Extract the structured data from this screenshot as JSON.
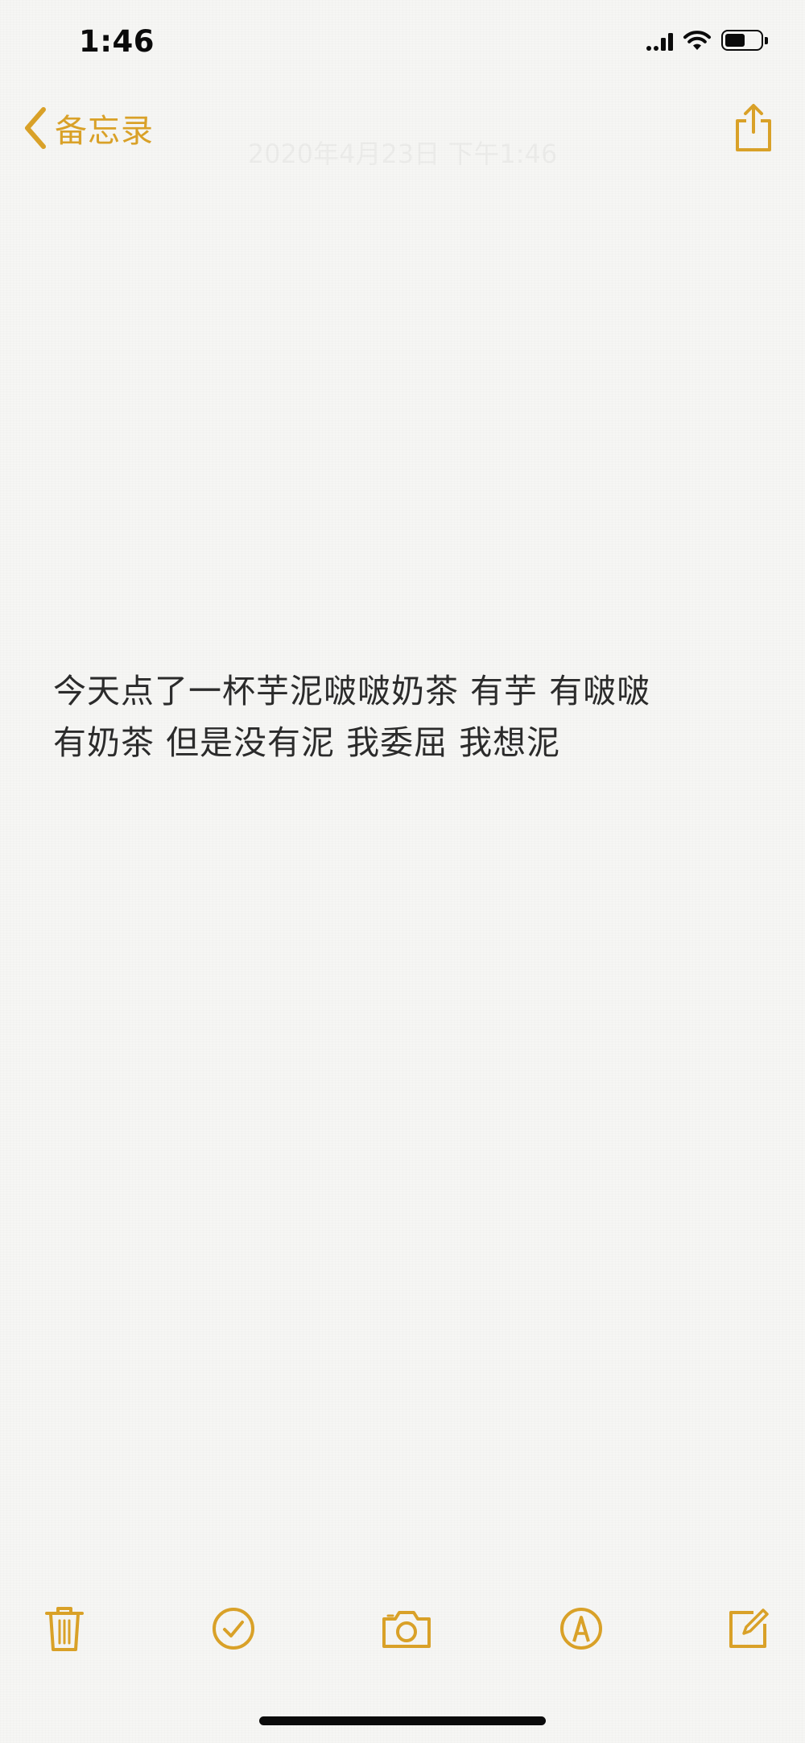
{
  "status_bar": {
    "time": "1:46"
  },
  "nav": {
    "back_label": "备忘录",
    "back_icon": "chevron-left-icon",
    "share_icon": "share-icon",
    "date_text": "2020年4月23日 下午1:46"
  },
  "note": {
    "lines": [
      "今天点了一杯芋泥啵啵奶茶 有芋 有啵啵",
      "有奶茶 但是没有泥 我委屈 我想泥"
    ]
  },
  "toolbar": {
    "icons": [
      "trash-icon",
      "checklist-icon",
      "camera-icon",
      "markup-icon",
      "compose-icon"
    ]
  },
  "colors": {
    "accent": "#d9a128",
    "text": "#2b2b2b",
    "background": "#f6f6f4"
  }
}
